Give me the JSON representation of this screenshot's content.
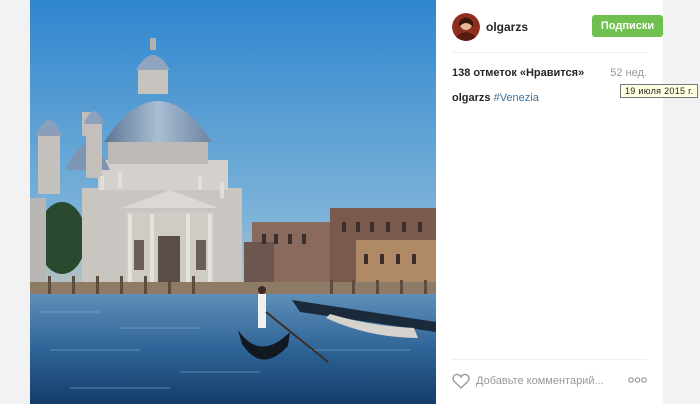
{
  "post": {
    "username": "olgarzs",
    "follow_label": "Подписки",
    "likes_text": "138 отметок «Нравится»",
    "time_ago": "52 нед.",
    "date_tooltip": "19 июля 2015 г.",
    "caption": {
      "username": "olgarzs",
      "hashtag": "#Venezia"
    },
    "comment_placeholder": "Добавьте комментарий..."
  },
  "icons": {
    "like": "heart-icon",
    "options": "more-options-icon"
  },
  "colors": {
    "follow_button": "#70c050",
    "hashtag": "#3f729b",
    "page_background": "#f2f2f2"
  }
}
